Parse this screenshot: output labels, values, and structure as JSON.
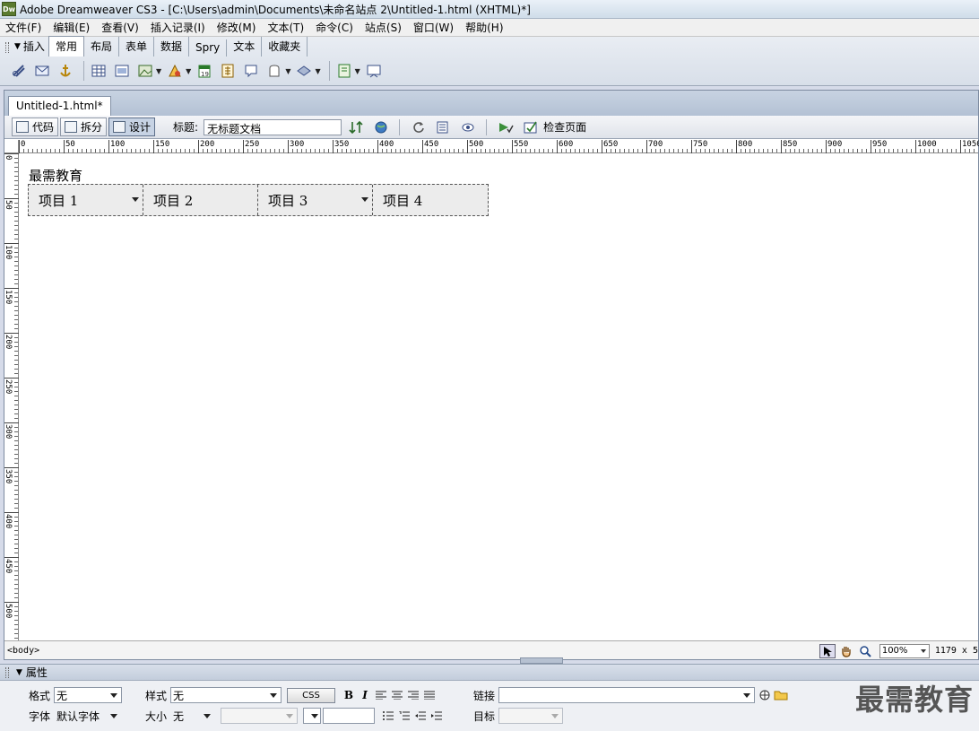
{
  "window": {
    "app_badge": "Dw",
    "title": "Adobe Dreamweaver CS3 - [C:\\Users\\admin\\Documents\\未命名站点 2\\Untitled-1.html (XHTML)*]"
  },
  "menubar": {
    "items": [
      "文件(F)",
      "编辑(E)",
      "查看(V)",
      "插入记录(I)",
      "修改(M)",
      "文本(T)",
      "命令(C)",
      "站点(S)",
      "窗口(W)",
      "帮助(H)"
    ]
  },
  "insert_bar": {
    "title": "插入",
    "tabs": [
      "常用",
      "布局",
      "表单",
      "数据",
      "Spry",
      "文本",
      "收藏夹"
    ],
    "active_tab": "常用"
  },
  "document": {
    "tab_label": "Untitled-1.html*",
    "view_buttons": {
      "code": "代码",
      "split": "拆分",
      "design": "设计"
    },
    "title_label": "标题:",
    "title_value": "无标题文档",
    "check_page_label": "检查页面",
    "ruler_labels": [
      "0",
      "50",
      "100",
      "150",
      "200",
      "250",
      "300",
      "350",
      "400",
      "450",
      "500",
      "550",
      "600",
      "650",
      "700",
      "750",
      "800",
      "850",
      "900",
      "950",
      "1000",
      "1050"
    ],
    "vruler_labels": [
      "0",
      "50",
      "100",
      "150",
      "200",
      "250",
      "300",
      "350",
      "400",
      "450",
      "500"
    ],
    "heading": "最需教育",
    "nav_items": [
      "项目 1",
      "项目 2",
      "项目 3",
      "项目 4"
    ]
  },
  "statusbar": {
    "tag_selector": "<body>",
    "zoom": "100%",
    "dimensions": "1179 x 5"
  },
  "properties": {
    "header": "属性",
    "format_label": "格式",
    "format_value": "无",
    "style_label": "样式",
    "style_value": "无",
    "css_button": "CSS",
    "bold": "B",
    "italic": "I",
    "link_label": "链接",
    "link_value": "",
    "font_label": "字体",
    "font_value": "默认字体",
    "size_label": "大小",
    "size_value": "无",
    "target_label": "目标",
    "watermark": "最需教育"
  }
}
